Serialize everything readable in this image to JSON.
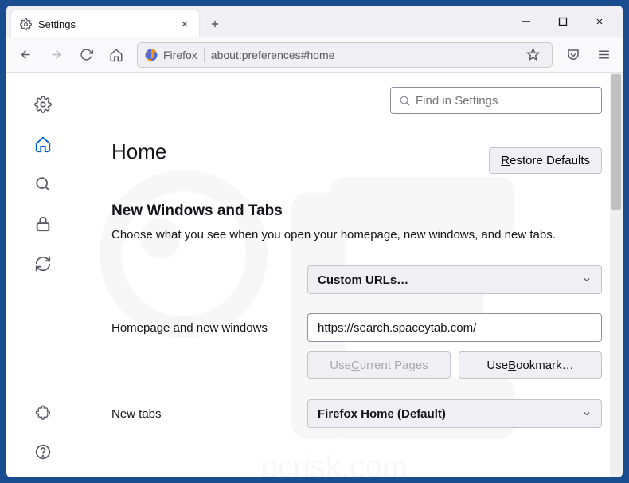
{
  "window": {
    "tab_title": "Settings",
    "url": "about:preferences#home",
    "url_identity": "Firefox"
  },
  "search": {
    "placeholder": "Find in Settings"
  },
  "page": {
    "title": "Home",
    "restore_btn": "Restore Defaults",
    "section_heading": "New Windows and Tabs",
    "section_desc": "Choose what you see when you open your homepage, new windows, and new tabs."
  },
  "home_dropdown": {
    "label": "Custom URLs…"
  },
  "homepage_row": {
    "label": "Homepage and new windows",
    "value": "https://search.spaceytab.com/"
  },
  "btns": {
    "use_current": "Use Current Pages",
    "use_bookmark": "Use Bookmark…"
  },
  "newtabs_row": {
    "label": "New tabs",
    "value": "Firefox Home (Default)"
  }
}
